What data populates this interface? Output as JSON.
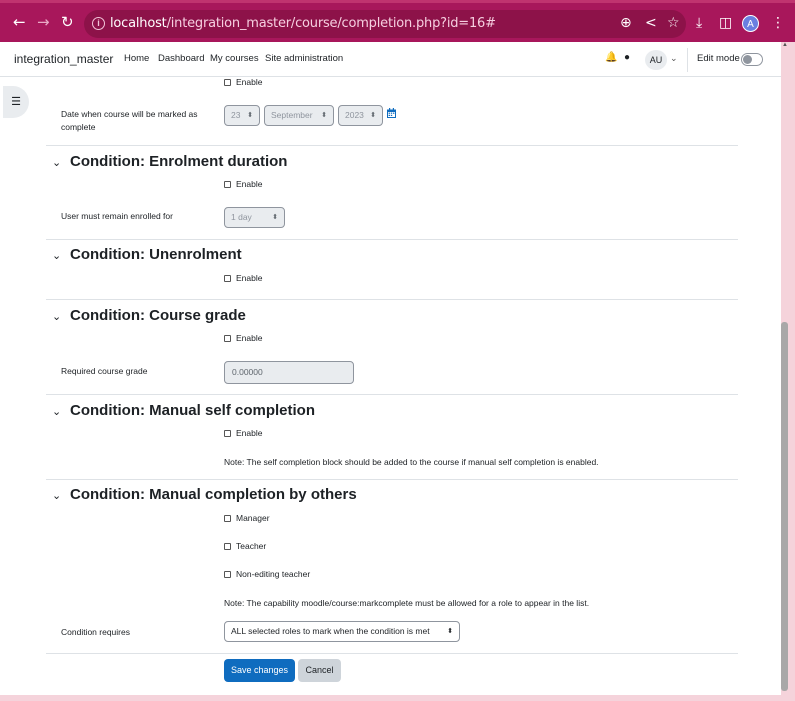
{
  "browser": {
    "url_host": "localhost",
    "url_path": "/integration_master/course/completion.php?id=16#",
    "profile_initial": "A"
  },
  "navbar": {
    "brand": "integration_master",
    "links": [
      "Home",
      "Dashboard",
      "My courses",
      "Site administration"
    ],
    "avatar": "AU",
    "edit_mode": "Edit mode"
  },
  "date_section": {
    "enable": "Enable",
    "label": "Date when course will be marked as complete",
    "day": "23",
    "month": "September",
    "year": "2023"
  },
  "enrolment_duration": {
    "title": "Condition: Enrolment duration",
    "enable": "Enable",
    "label": "User must remain enrolled for",
    "value": "1 day"
  },
  "unenrolment": {
    "title": "Condition: Unenrolment",
    "enable": "Enable"
  },
  "course_grade": {
    "title": "Condition: Course grade",
    "enable": "Enable",
    "label": "Required course grade",
    "value": "0.00000"
  },
  "self_completion": {
    "title": "Condition: Manual self completion",
    "enable": "Enable",
    "note": "Note: The self completion block should be added to the course if manual self completion is enabled."
  },
  "completion_by_others": {
    "title": "Condition: Manual completion by others",
    "roles": [
      "Manager",
      "Teacher",
      "Non-editing teacher"
    ],
    "note": "Note: The capability moodle/course:markcomplete must be allowed for a role to appear in the list.",
    "requires_label": "Condition requires",
    "requires_value": "ALL selected roles to mark when the condition is met"
  },
  "buttons": {
    "save": "Save changes",
    "cancel": "Cancel"
  },
  "colors": {
    "browser_bar": "#a8175b",
    "primary": "#0f6cbf",
    "page_bg": "#f5d3db"
  }
}
